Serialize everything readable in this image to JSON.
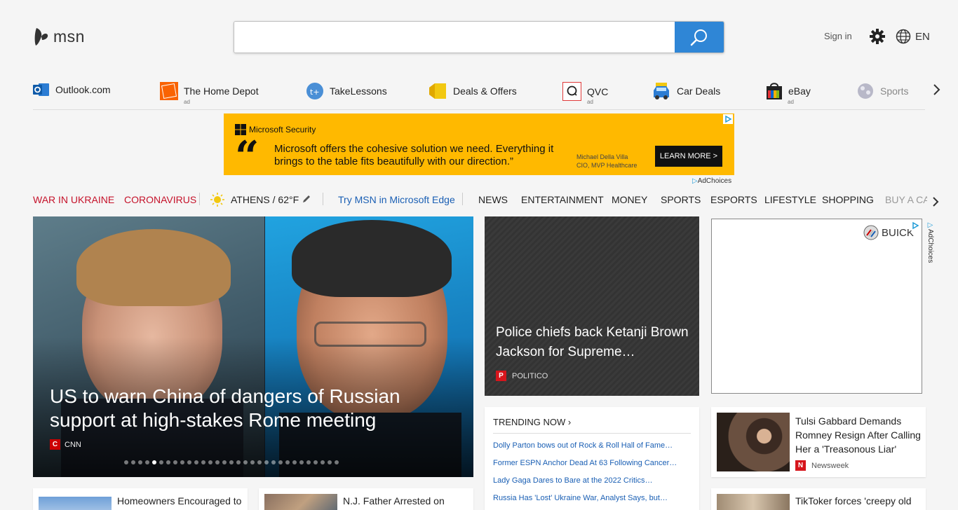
{
  "header": {
    "logo_text": "msn",
    "search": {
      "value": "",
      "placeholder": ""
    },
    "signin": "Sign in",
    "language": "EN"
  },
  "quick_links": [
    {
      "label": "Outlook.com",
      "ad": ""
    },
    {
      "label": "The Home Depot",
      "ad": "ad"
    },
    {
      "label": "TakeLessons",
      "ad": ""
    },
    {
      "label": "Deals & Offers",
      "ad": ""
    },
    {
      "label": "QVC",
      "ad": "ad"
    },
    {
      "label": "Car Deals",
      "ad": ""
    },
    {
      "label": "eBay",
      "ad": "ad"
    },
    {
      "label": "Sports",
      "ad": ""
    }
  ],
  "banner_ad": {
    "brand": "Microsoft Security",
    "quote": "Microsoft offers the cohesive solution we need. Everything it brings to the table fits beautifully with our direction.”",
    "attribution_name": "Michael Della Villa",
    "attribution_title": "CIO, MVP Healthcare",
    "cta": "LEARN MORE >",
    "adchoices": "AdChoices"
  },
  "nav": {
    "war": "WAR IN UKRAINE",
    "coronavirus": "CORONAVIRUS",
    "weather": "ATHENS / 62°F",
    "edge": "Try MSN in Microsoft Edge",
    "items": [
      "NEWS",
      "ENTERTAINMENT",
      "MONEY",
      "SPORTS",
      "ESPORTS",
      "LIFESTYLE",
      "SHOPPING",
      "BUY A CA"
    ]
  },
  "hero": {
    "title": "US to warn China of dangers of Russian support at high-stakes Rome meeting",
    "source": "CNN",
    "slide_count": 31,
    "active_slide": 4
  },
  "feature": {
    "title": "Police chiefs back Ketanji Brown Jackson for Supreme…",
    "source": "POLITICO"
  },
  "ad_box": {
    "brand": "BUICK",
    "adchoices": "AdChoices"
  },
  "trending": {
    "heading": "TRENDING NOW ›",
    "items": [
      "Dolly Parton bows out of Rock & Roll Hall of Fame…",
      "Former ESPN Anchor Dead At 63 Following Cancer…",
      "Lady Gaga Dares to Bare at the 2022 Critics…",
      "Russia Has 'Lost' Ukraine War, Analyst Says, but…"
    ]
  },
  "cards": [
    {
      "title": "Tulsi Gabbard Demands Romney Resign After Calling Her a 'Treasonous Liar'",
      "source": "Newsweek"
    },
    {
      "title": "Homeowners Encouraged to",
      "source": ""
    },
    {
      "title": "N.J. Father Arrested on",
      "source": ""
    },
    {
      "title": "TikToker forces 'creepy old",
      "source": ""
    }
  ],
  "colors": {
    "search_button": "#2f86d6",
    "nav_red": "#c5122a",
    "nav_blue": "#1a5fb4",
    "banner_bg": "#ffb900"
  }
}
